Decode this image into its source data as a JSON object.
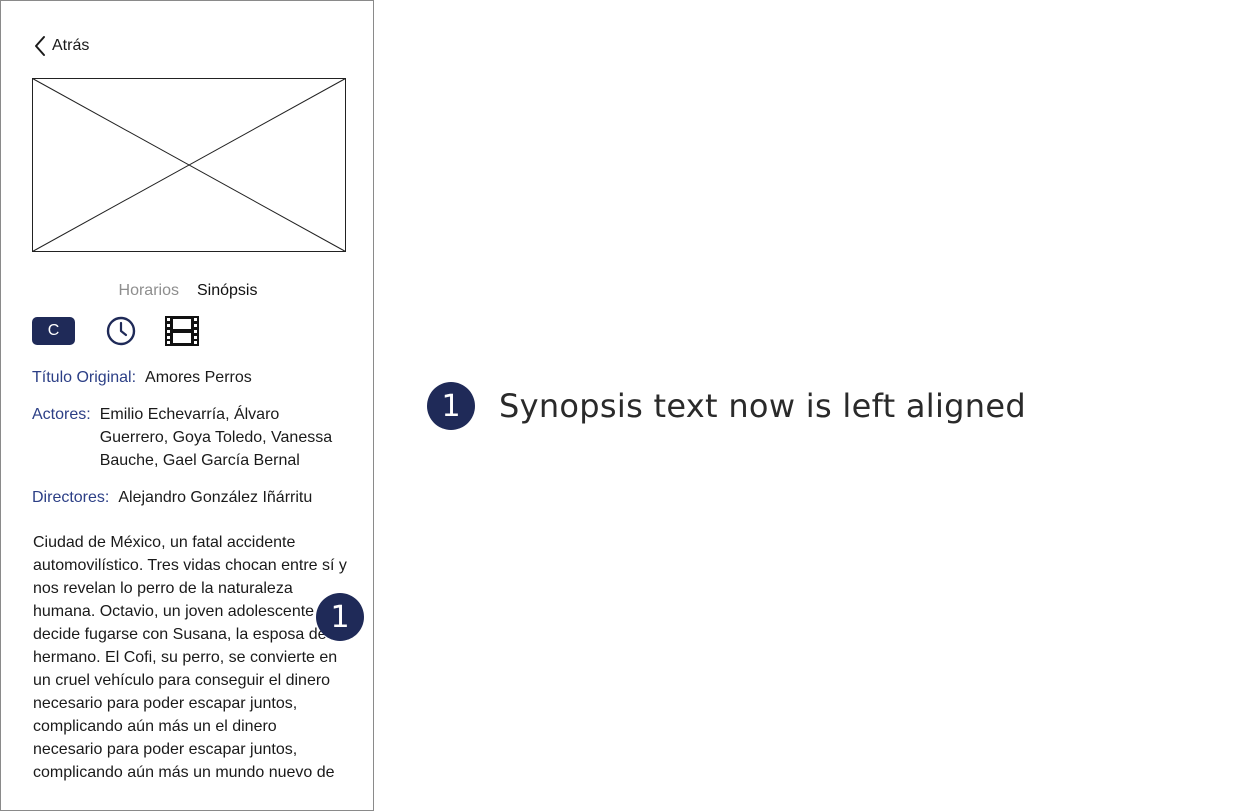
{
  "header": {
    "back_label": "Atrás"
  },
  "poster": {
    "alt": "image placeholder"
  },
  "tabs": [
    {
      "label": "Horarios",
      "active": false
    },
    {
      "label": "Sinópsis",
      "active": true
    }
  ],
  "icons": {
    "rating_label": "C",
    "clock": "clock-icon",
    "film": "film-icon"
  },
  "details": {
    "title_label": "Título Original:",
    "title_value": "Amores Perros",
    "actors_label": "Actores:",
    "actors_value": "Emilio Echevarría, Álvaro Guerrero, Goya Toledo, Vanessa Bauche, Gael García Bernal",
    "directors_label": "Directores:",
    "directors_value": "Alejandro González Iñárritu"
  },
  "synopsis": "Ciudad de México, un fatal accidente automovilístico. Tres vidas chocan entre sí y nos revelan lo perro de la naturaleza humana. Octavio, un joven adolescente decide fugarse con Susana, la esposa de su hermano. El Cofi, su perro, se convierte en un cruel vehículo para conseguir el dinero necesario para poder escapar juntos, complicando aún más un  el dinero necesario para poder escapar juntos, complicando aún más un mundo nuevo de",
  "annotation": {
    "marker": "1",
    "text": "Synopsis text now is left aligned"
  },
  "colors": {
    "accent": "#1f2a58",
    "label": "#2c3f86",
    "inactive_tab": "#8e8e8e"
  }
}
